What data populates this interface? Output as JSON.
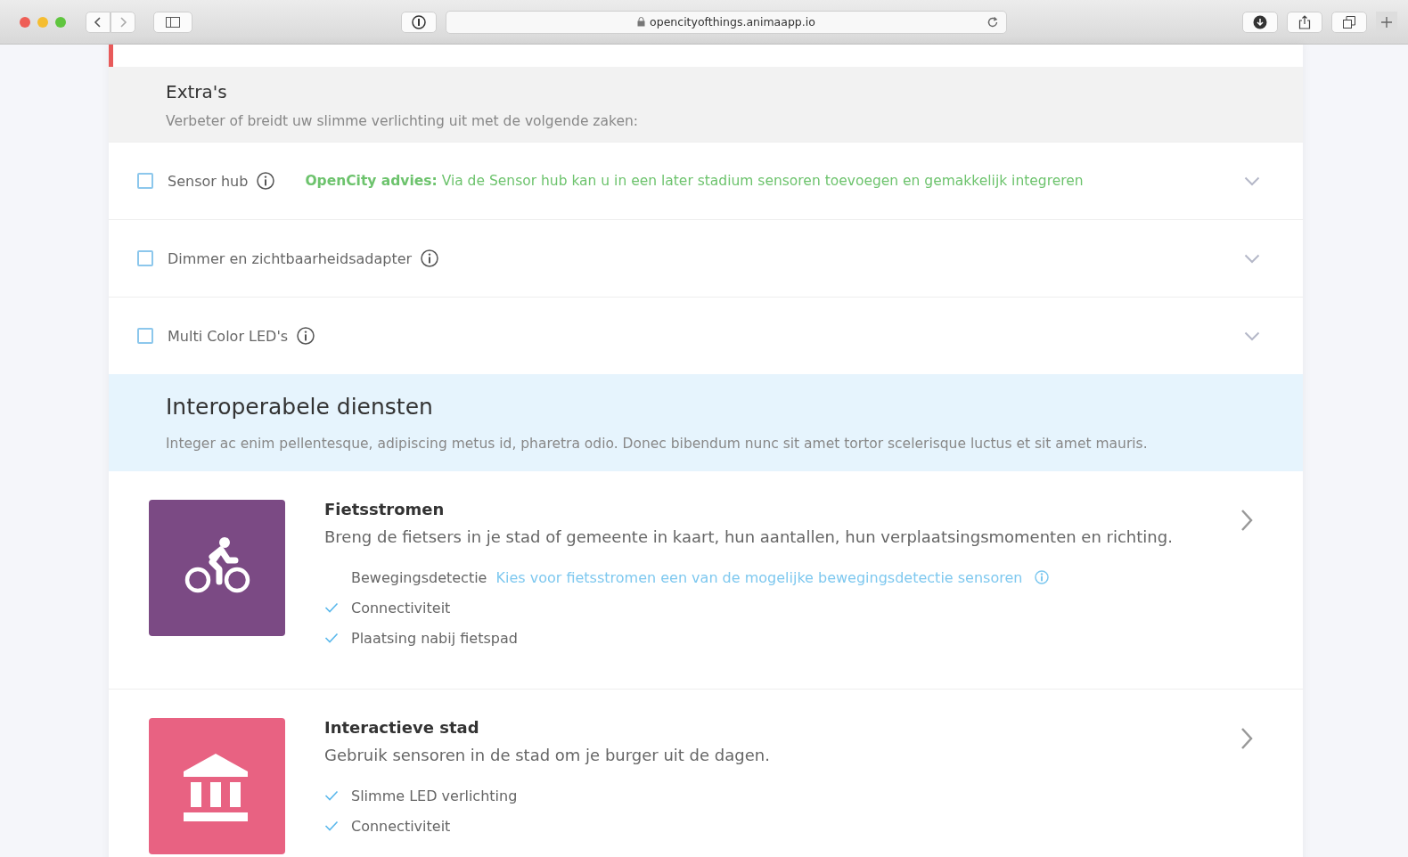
{
  "browser": {
    "url": "opencityofthings.animaapp.io"
  },
  "extras": {
    "title": "Extra's",
    "subtitle": "Verbeter of breidt uw slimme verlichting uit met de volgende zaken:",
    "items": [
      {
        "label": "Sensor hub",
        "checked": false,
        "advice": "**OpenCity advies:** Via de Sensor hub kan u in een later stadium sensoren toevoegen en gemakkelijk integreren"
      },
      {
        "label": "Dimmer en zichtbaarheidsadapter",
        "checked": false
      },
      {
        "label": "Multi Color LED's",
        "checked": false
      }
    ]
  },
  "services": {
    "title": "Interoperabele diensten",
    "subtitle": "Integer ac enim pellentesque, adipiscing metus id, pharetra odio. Donec bibendum nunc sit amet tortor scelerisque luctus et sit amet mauris.",
    "items": [
      {
        "kind": "bicycle",
        "color": "#7b4a84",
        "title": "Fietsstromen",
        "description": "Breng de fietsers in je stad of gemeente in kaart, hun aantallen, hun verplaatsingsmomenten en richting.",
        "features": [
          {
            "kind": "choice",
            "label": "Bewegingsdetectie",
            "link": "Kies voor fietsstromen een van de mogelijke bewegingsdetectie sensoren"
          },
          {
            "kind": "check",
            "label": "Connectiviteit"
          },
          {
            "kind": "check",
            "label": "Plaatsing nabij fietspad"
          }
        ]
      },
      {
        "kind": "building",
        "color": "#e86282",
        "title": "Interactieve stad",
        "description": "Gebruik sensoren in de stad om je burger uit de dagen.",
        "features": [
          {
            "kind": "check",
            "label": "Slimme LED verlichting"
          },
          {
            "kind": "check",
            "label": "Connectiviteit"
          }
        ]
      }
    ]
  }
}
